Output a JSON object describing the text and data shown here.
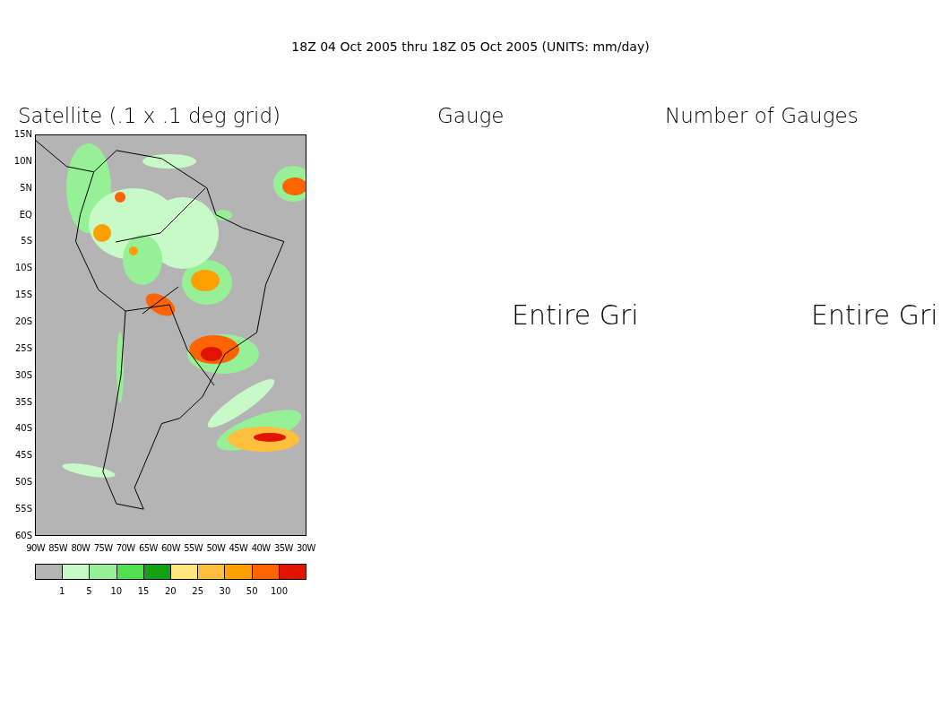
{
  "title": "18Z 04 Oct 2005 thru 18Z 05 Oct 2005 (UNITS: mm/day)",
  "panels": [
    {
      "kind": "map",
      "heading": "Satellite (.1 x .1 deg grid)",
      "lat_labels": [
        "15N",
        "10N",
        "5N",
        "EQ",
        "5S",
        "10S",
        "15S",
        "20S",
        "25S",
        "30S",
        "35S",
        "40S",
        "45S",
        "50S",
        "55S",
        "60S"
      ],
      "lon_labels": [
        "90W",
        "85W",
        "80W",
        "75W",
        "70W",
        "65W",
        "60W",
        "55W",
        "50W",
        "45W",
        "40W",
        "35W",
        "30W"
      ],
      "legend": {
        "colors": [
          {
            "color": "#b4b4b4"
          },
          {
            "color": "#c8fac8"
          },
          {
            "color": "#96f096"
          },
          {
            "color": "#50e050"
          },
          {
            "color": "#14a014"
          },
          {
            "color": "#ffe678"
          },
          {
            "color": "#ffbe3c"
          },
          {
            "color": "#ffa000"
          },
          {
            "color": "#ff6400"
          },
          {
            "color": "#e11400"
          }
        ],
        "labels": [
          "1",
          "5",
          "10",
          "15",
          "20",
          "25",
          "30",
          "50",
          "100"
        ]
      }
    },
    {
      "kind": "message",
      "heading": "Gauge",
      "message": "Entire Gri"
    },
    {
      "kind": "message",
      "heading": "Number of Gauges",
      "message": "Entire Gri"
    }
  ]
}
